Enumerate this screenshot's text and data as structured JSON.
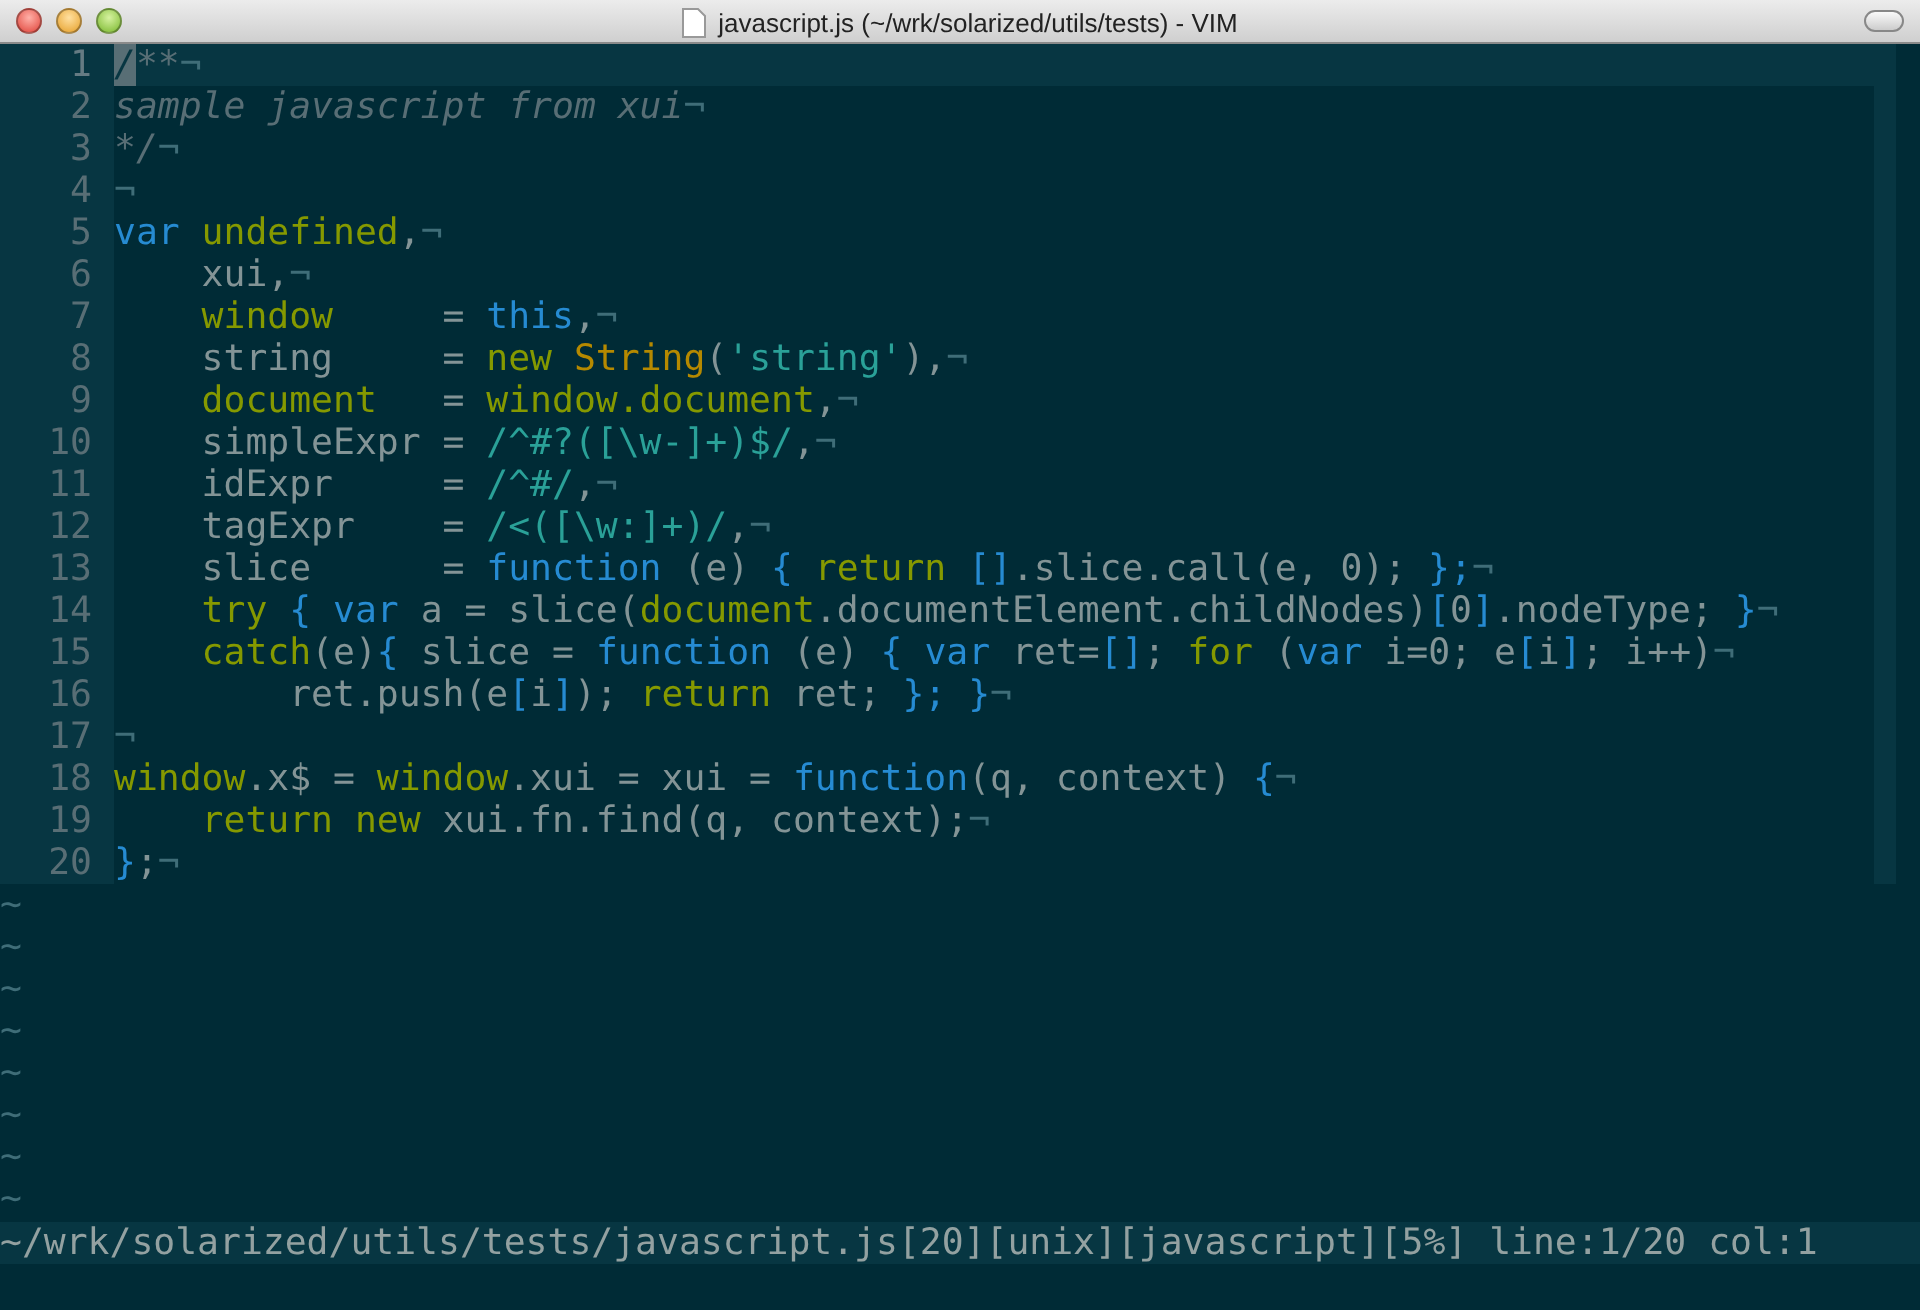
{
  "window": {
    "title": "javascript.js (~/wrk/solarized/utils/tests) - VIM"
  },
  "editor": {
    "lines": [
      {
        "number": "1",
        "cursor_line": true,
        "tokens": [
          {
            "kind": "comment",
            "text": "/**"
          },
          {
            "kind": "eol",
            "text": "¬"
          }
        ]
      },
      {
        "number": "2",
        "cursor_line": false,
        "tokens": [
          {
            "kind": "comment",
            "text": "sample javascript from xui"
          },
          {
            "kind": "eol",
            "text": "¬"
          }
        ]
      },
      {
        "number": "3",
        "cursor_line": false,
        "tokens": [
          {
            "kind": "comment",
            "text": "*/"
          },
          {
            "kind": "eol",
            "text": "¬"
          }
        ]
      },
      {
        "number": "4",
        "cursor_line": false,
        "tokens": [
          {
            "kind": "eol",
            "text": "¬"
          }
        ]
      },
      {
        "number": "5",
        "cursor_line": false,
        "tokens": [
          {
            "kind": "identifier",
            "text": "var"
          },
          {
            "kind": "statement",
            "text": " undefined"
          },
          {
            "kind": "plain",
            "text": ","
          },
          {
            "kind": "eol",
            "text": "¬"
          }
        ]
      },
      {
        "number": "6",
        "cursor_line": false,
        "tokens": [
          {
            "kind": "plain",
            "text": "    xui,"
          },
          {
            "kind": "eol",
            "text": "¬"
          }
        ]
      },
      {
        "number": "7",
        "cursor_line": false,
        "tokens": [
          {
            "kind": "statement",
            "text": "    window"
          },
          {
            "kind": "plain",
            "text": "     = "
          },
          {
            "kind": "identifier",
            "text": "this"
          },
          {
            "kind": "plain",
            "text": ","
          },
          {
            "kind": "eol",
            "text": "¬"
          }
        ]
      },
      {
        "number": "8",
        "cursor_line": false,
        "tokens": [
          {
            "kind": "plain",
            "text": "    string     = "
          },
          {
            "kind": "statement",
            "text": "new"
          },
          {
            "kind": "type",
            "text": " String"
          },
          {
            "kind": "plain",
            "text": "("
          },
          {
            "kind": "constant",
            "text": "'string'"
          },
          {
            "kind": "plain",
            "text": "),"
          },
          {
            "kind": "eol",
            "text": "¬"
          }
        ]
      },
      {
        "number": "9",
        "cursor_line": false,
        "tokens": [
          {
            "kind": "statement",
            "text": "    document"
          },
          {
            "kind": "plain",
            "text": "   = "
          },
          {
            "kind": "statement",
            "text": "window.document"
          },
          {
            "kind": "plain",
            "text": ","
          },
          {
            "kind": "eol",
            "text": "¬"
          }
        ]
      },
      {
        "number": "10",
        "cursor_line": false,
        "tokens": [
          {
            "kind": "plain",
            "text": "    simpleExpr = "
          },
          {
            "kind": "constant",
            "text": "/^#?([\\w-]+)$/"
          },
          {
            "kind": "plain",
            "text": ","
          },
          {
            "kind": "eol",
            "text": "¬"
          }
        ]
      },
      {
        "number": "11",
        "cursor_line": false,
        "tokens": [
          {
            "kind": "plain",
            "text": "    idExpr     = "
          },
          {
            "kind": "constant",
            "text": "/^#/"
          },
          {
            "kind": "plain",
            "text": ","
          },
          {
            "kind": "eol",
            "text": "¬"
          }
        ]
      },
      {
        "number": "12",
        "cursor_line": false,
        "tokens": [
          {
            "kind": "plain",
            "text": "    tagExpr    = "
          },
          {
            "kind": "constant",
            "text": "/<([\\w:]+)/"
          },
          {
            "kind": "plain",
            "text": ","
          },
          {
            "kind": "eol",
            "text": "¬"
          }
        ]
      },
      {
        "number": "13",
        "cursor_line": false,
        "tokens": [
          {
            "kind": "plain",
            "text": "    slice      = "
          },
          {
            "kind": "identifier",
            "text": "function"
          },
          {
            "kind": "plain",
            "text": " (e) "
          },
          {
            "kind": "identifier",
            "text": "{"
          },
          {
            "kind": "statement",
            "text": " return"
          },
          {
            "kind": "identifier",
            "text": " []"
          },
          {
            "kind": "plain",
            "text": ".slice.call(e, 0); "
          },
          {
            "kind": "identifier",
            "text": "};"
          },
          {
            "kind": "eol",
            "text": "¬"
          }
        ]
      },
      {
        "number": "14",
        "cursor_line": false,
        "tokens": [
          {
            "kind": "statement",
            "text": "    try"
          },
          {
            "kind": "identifier",
            "text": " {"
          },
          {
            "kind": "identifier",
            "text": " var"
          },
          {
            "kind": "plain",
            "text": " a = slice("
          },
          {
            "kind": "statement",
            "text": "document"
          },
          {
            "kind": "plain",
            "text": ".documentElement.childNodes)"
          },
          {
            "kind": "identifier",
            "text": "["
          },
          {
            "kind": "plain",
            "text": "0"
          },
          {
            "kind": "identifier",
            "text": "]"
          },
          {
            "kind": "plain",
            "text": ".nodeType; "
          },
          {
            "kind": "identifier",
            "text": "}"
          },
          {
            "kind": "eol",
            "text": "¬"
          }
        ]
      },
      {
        "number": "15",
        "cursor_line": false,
        "tokens": [
          {
            "kind": "statement",
            "text": "    catch"
          },
          {
            "kind": "plain",
            "text": "(e)"
          },
          {
            "kind": "identifier",
            "text": "{"
          },
          {
            "kind": "plain",
            "text": " slice = "
          },
          {
            "kind": "identifier",
            "text": "function"
          },
          {
            "kind": "plain",
            "text": " (e) "
          },
          {
            "kind": "identifier",
            "text": "{"
          },
          {
            "kind": "identifier",
            "text": " var"
          },
          {
            "kind": "plain",
            "text": " ret="
          },
          {
            "kind": "identifier",
            "text": "[]"
          },
          {
            "kind": "plain",
            "text": "; "
          },
          {
            "kind": "statement",
            "text": "for"
          },
          {
            "kind": "plain",
            "text": " ("
          },
          {
            "kind": "identifier",
            "text": "var"
          },
          {
            "kind": "plain",
            "text": " i=0; e"
          },
          {
            "kind": "identifier",
            "text": "["
          },
          {
            "kind": "plain",
            "text": "i"
          },
          {
            "kind": "identifier",
            "text": "]"
          },
          {
            "kind": "plain",
            "text": "; i++)"
          },
          {
            "kind": "eol",
            "text": "¬"
          }
        ]
      },
      {
        "number": "16",
        "cursor_line": false,
        "tokens": [
          {
            "kind": "plain",
            "text": "        ret.push(e"
          },
          {
            "kind": "identifier",
            "text": "["
          },
          {
            "kind": "plain",
            "text": "i"
          },
          {
            "kind": "identifier",
            "text": "]"
          },
          {
            "kind": "plain",
            "text": "); "
          },
          {
            "kind": "statement",
            "text": "return"
          },
          {
            "kind": "plain",
            "text": " ret; "
          },
          {
            "kind": "identifier",
            "text": "};"
          },
          {
            "kind": "identifier",
            "text": " }"
          },
          {
            "kind": "eol",
            "text": "¬"
          }
        ]
      },
      {
        "number": "17",
        "cursor_line": false,
        "tokens": [
          {
            "kind": "eol",
            "text": "¬"
          }
        ]
      },
      {
        "number": "18",
        "cursor_line": false,
        "tokens": [
          {
            "kind": "statement",
            "text": "window"
          },
          {
            "kind": "plain",
            "text": ".x$ = "
          },
          {
            "kind": "statement",
            "text": "window"
          },
          {
            "kind": "plain",
            "text": ".xui = xui = "
          },
          {
            "kind": "identifier",
            "text": "function"
          },
          {
            "kind": "plain",
            "text": "(q, context) "
          },
          {
            "kind": "identifier",
            "text": "{"
          },
          {
            "kind": "eol",
            "text": "¬"
          }
        ]
      },
      {
        "number": "19",
        "cursor_line": false,
        "tokens": [
          {
            "kind": "statement",
            "text": "    return"
          },
          {
            "kind": "statement",
            "text": " new"
          },
          {
            "kind": "plain",
            "text": " xui.fn.find(q, context);"
          },
          {
            "kind": "eol",
            "text": "¬"
          }
        ]
      },
      {
        "number": "20",
        "cursor_line": false,
        "tokens": [
          {
            "kind": "identifier",
            "text": "}"
          },
          {
            "kind": "plain",
            "text": ";"
          },
          {
            "kind": "eol",
            "text": "¬"
          }
        ]
      }
    ],
    "filler": [
      "~",
      "~",
      "~",
      "~",
      "~",
      "~",
      "~",
      "~"
    ]
  },
  "status_line": "~/wrk/solarized/utils/tests/javascript.js[20][unix][javascript][5%] line:1/20 col:1"
}
